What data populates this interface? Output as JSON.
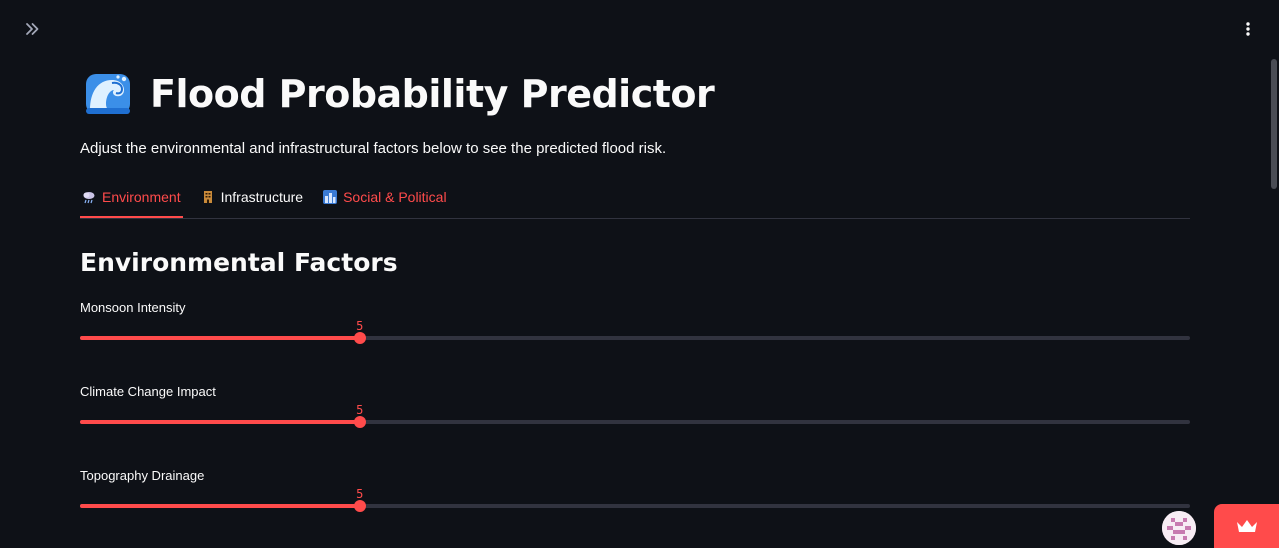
{
  "header": {
    "sidebar_toggle_icon": "double-chevron-right-icon",
    "menu_icon": "vertical-ellipsis-icon"
  },
  "page": {
    "title_icon": "water-wave-icon",
    "title": "Flood Probability Predictor",
    "subtitle": "Adjust the environmental and infrastructural factors below to see the predicted flood risk."
  },
  "tabs": [
    {
      "label": "Environment",
      "icon": "rain-cloud-icon",
      "active": true
    },
    {
      "label": "Infrastructure",
      "icon": "building-icon",
      "active": false
    },
    {
      "label": "Social & Political",
      "icon": "city-icon",
      "active": false
    }
  ],
  "section": {
    "heading": "Environmental Factors"
  },
  "sliders": [
    {
      "label": "Monsoon Intensity",
      "value": "5",
      "fraction": 0.252
    },
    {
      "label": "Climate Change Impact",
      "value": "5",
      "fraction": 0.252
    },
    {
      "label": "Topography Drainage",
      "value": "5",
      "fraction": 0.252
    }
  ],
  "colors": {
    "accent": "#ff4b4b",
    "background": "#0e1117",
    "track": "#31333f",
    "text": "#fafafa"
  },
  "footer": {
    "avatar_icon": "user-avatar-icon",
    "manage_app_icon": "crown-icon"
  }
}
